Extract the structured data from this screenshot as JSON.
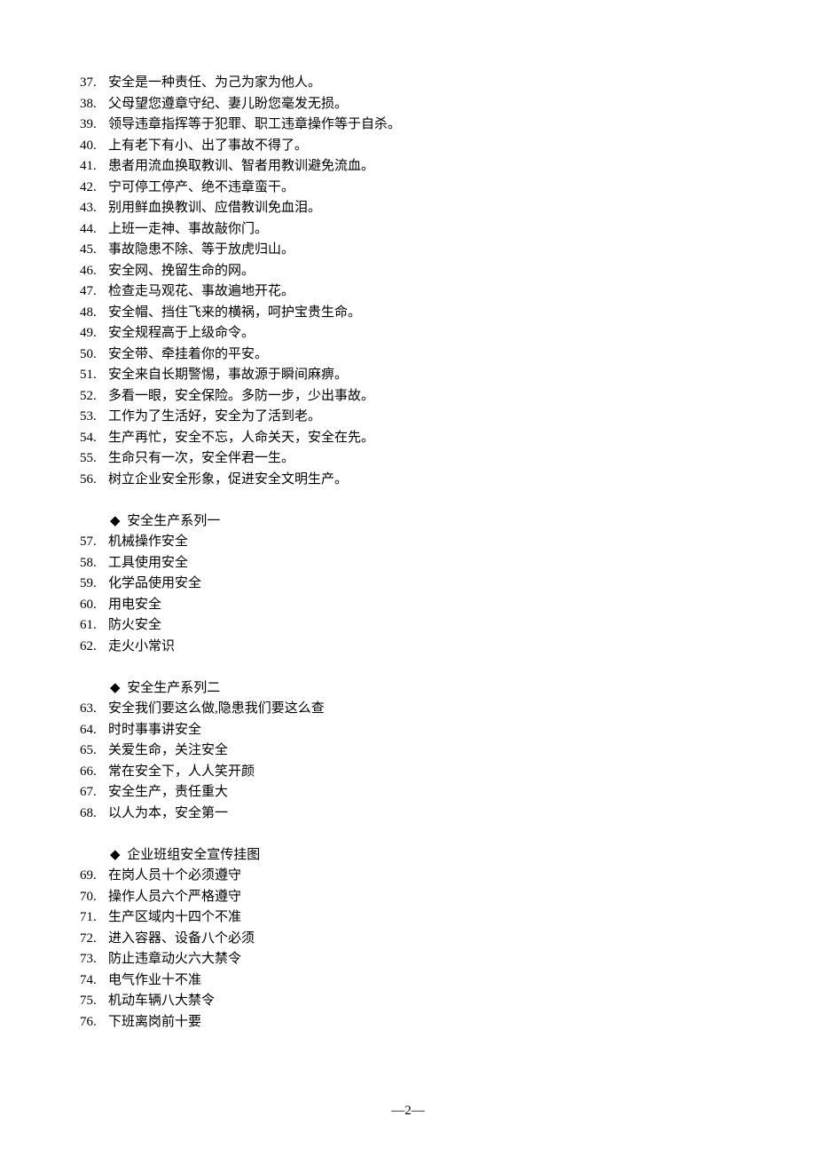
{
  "lines_block1": [
    {
      "n": "37.",
      "t": "安全是一种责任、为己为家为他人。"
    },
    {
      "n": "38.",
      "t": "父母望您遵章守纪、妻儿盼您毫发无损。"
    },
    {
      "n": "39.",
      "t": "领导违章指挥等于犯罪、职工违章操作等于自杀。"
    },
    {
      "n": "40.",
      "t": "上有老下有小、出了事故不得了。"
    },
    {
      "n": "41.",
      "t": "患者用流血换取教训、智者用教训避免流血。"
    },
    {
      "n": "42.",
      "t": "宁可停工停产、绝不违章蛮干。"
    },
    {
      "n": "43.",
      "t": "别用鲜血换教训、应借教训免血泪。"
    },
    {
      "n": "44.",
      "t": "上班一走神、事故敲你门。"
    },
    {
      "n": "45.",
      "t": "事故隐患不除、等于放虎归山。"
    },
    {
      "n": "46.",
      "t": "安全网、挽留生命的网。"
    },
    {
      "n": "47.",
      "t": "检查走马观花、事故遍地开花。"
    },
    {
      "n": "48.",
      "t": "安全帽、挡住飞来的横祸，呵护宝贵生命。"
    },
    {
      "n": "49.",
      "t": "安全规程高于上级命令。"
    },
    {
      "n": "50.",
      "t": "安全带、牵挂着你的平安。"
    },
    {
      "n": "51.",
      "t": "安全来自长期警惕，事故源于瞬间麻痹。"
    },
    {
      "n": "52.",
      "t": "多看一眼，安全保险。多防一步，少出事故。"
    },
    {
      "n": "53.",
      "t": "工作为了生活好，安全为了活到老。"
    },
    {
      "n": "54.",
      "t": "生产再忙，安全不忘，人命关天，安全在先。"
    },
    {
      "n": "55.",
      "t": "生命只有一次，安全伴君一生。"
    },
    {
      "n": "56.",
      "t": "树立企业安全形象，促进安全文明生产。"
    }
  ],
  "section1": {
    "heading": "安全生产系列一",
    "items": [
      {
        "n": "57.",
        "t": "机械操作安全"
      },
      {
        "n": "58.",
        "t": "工具使用安全"
      },
      {
        "n": "59.",
        "t": "化学品使用安全"
      },
      {
        "n": "60.",
        "t": "用电安全"
      },
      {
        "n": "61.",
        "t": "防火安全"
      },
      {
        "n": "62.",
        "t": "走火小常识"
      }
    ]
  },
  "section2": {
    "heading": "安全生产系列二",
    "items": [
      {
        "n": "63.",
        "t": "安全我们要这么做,隐患我们要这么查"
      },
      {
        "n": "64.",
        "t": "时时事事讲安全"
      },
      {
        "n": "65.",
        "t": "关爱生命，关注安全"
      },
      {
        "n": "66.",
        "t": "常在安全下，人人笑开颜"
      },
      {
        "n": "67.",
        "t": "安全生产，责任重大"
      },
      {
        "n": "68.",
        "t": "以人为本，安全第一"
      }
    ]
  },
  "section3": {
    "heading": "企业班组安全宣传挂图",
    "items": [
      {
        "n": "69.",
        "t": "在岗人员十个必须遵守"
      },
      {
        "n": "70.",
        "t": "操作人员六个严格遵守"
      },
      {
        "n": "71.",
        "t": "生产区域内十四个不准"
      },
      {
        "n": "72.",
        "t": "进入容器、设备八个必须"
      },
      {
        "n": "73.",
        "t": "防止违章动火六大禁令"
      },
      {
        "n": "74.",
        "t": "电气作业十不准"
      },
      {
        "n": "75.",
        "t": "机动车辆八大禁令"
      },
      {
        "n": "76.",
        "t": "下班离岗前十要"
      }
    ]
  },
  "diamond_glyph": "◆",
  "page_number": "―2―"
}
